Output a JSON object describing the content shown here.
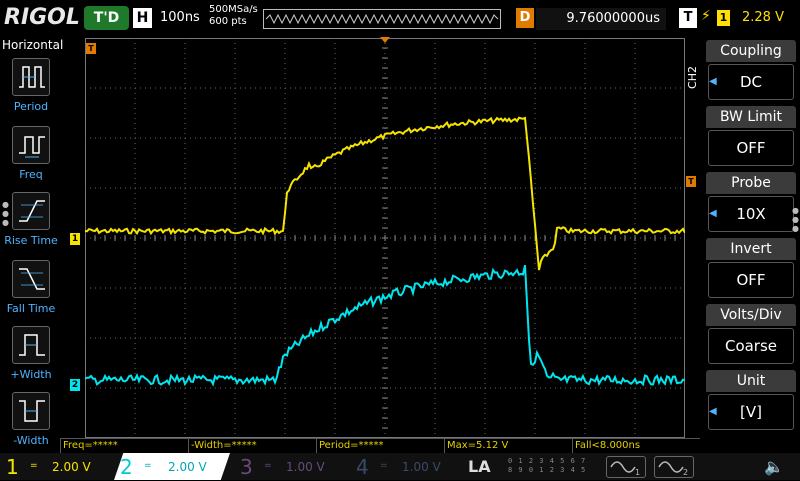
{
  "topbar": {
    "logo": "RIGOL",
    "trigger_status": "T'D",
    "horizontal_icon": "H",
    "timebase": "100ns",
    "sample_rate": "500MSa/s",
    "memory_depth": "600 pts",
    "delay_icon": "D",
    "delay": "9.76000000us",
    "trigger_icon": "T",
    "trigger_slope_icon": "rising-edge-icon",
    "trigger_source": "1",
    "trigger_level": "2.28 V"
  },
  "left_panel": {
    "title": "Horizontal",
    "items": [
      {
        "label": "Period",
        "icon": "period-icon"
      },
      {
        "label": "Freq",
        "icon": "frequency-icon"
      },
      {
        "label": "Rise Time",
        "icon": "rise-time-icon"
      },
      {
        "label": "Fall Time",
        "icon": "fall-time-icon"
      },
      {
        "label": "+Width",
        "icon": "positive-width-icon"
      },
      {
        "label": "-Width",
        "icon": "negative-width-icon"
      }
    ]
  },
  "right_panel": {
    "channel_tab": "CH2",
    "menus": [
      {
        "title": "Coupling",
        "value": "DC",
        "has_arrow": true
      },
      {
        "title": "BW Limit",
        "value": "OFF",
        "has_arrow": false
      },
      {
        "title": "Probe",
        "value": "10X",
        "has_arrow": true
      },
      {
        "title": "Invert",
        "value": "OFF",
        "has_arrow": false
      },
      {
        "title": "Volts/Div",
        "value": "Coarse",
        "has_arrow": false
      },
      {
        "title": "Unit",
        "value": "[V]",
        "has_arrow": true
      }
    ]
  },
  "markers": {
    "ch1": "1",
    "ch2": "2",
    "trigger_pos": "T",
    "trigger_level": "T"
  },
  "measurements": [
    "Freq=*****",
    "-Width=*****",
    "Period=*****",
    "Max=5.12 V",
    "Fall<8.000ns"
  ],
  "bottombar": {
    "channels": [
      {
        "num": "1",
        "coupling": "=",
        "scale": "2.00 V",
        "color": "#f5e400",
        "active": true
      },
      {
        "num": "2",
        "coupling": "=",
        "scale": "2.00 V",
        "color": "#00e5ee",
        "active": true
      },
      {
        "num": "3",
        "coupling": "=",
        "scale": "1.00 V",
        "color": "#6a4a7a",
        "active": false
      },
      {
        "num": "4",
        "coupling": "=",
        "scale": "1.00 V",
        "color": "#3a4a6a",
        "active": false
      }
    ],
    "la_label": "LA",
    "digital_row1": "0 1 2 3   4 5 6 7",
    "digital_row2": "8 9 0 1   2 3 4 5",
    "gen1": "1",
    "gen2": "2",
    "sound_icon": "speaker-muted-icon"
  },
  "colors": {
    "ch1": "#f5e400",
    "ch2": "#00e5ee",
    "trigger": "#e07b00",
    "accent": "#4fb3ff"
  }
}
